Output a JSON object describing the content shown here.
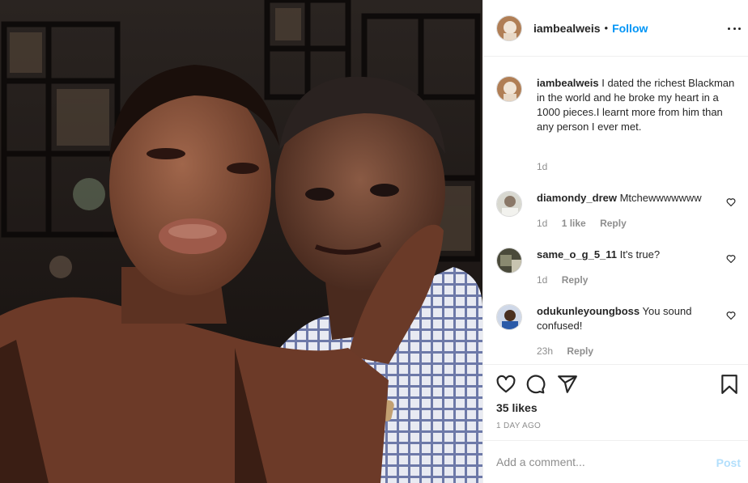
{
  "post": {
    "username": "iambealweis",
    "separator": "•",
    "follow_label": "Follow",
    "more_icon": "more-horizontal-icon"
  },
  "caption": {
    "username": "iambealweis",
    "text": " I dated the richest Blackman in the world and he broke my heart in a 1000 pieces.I learnt more from him than any person I ever met.",
    "time": "1d"
  },
  "comments": [
    {
      "username": "diamondy_drew",
      "text": " Mtchewwwwwww",
      "time": "1d",
      "likes": "1 like",
      "reply": "Reply"
    },
    {
      "username": "same_o_g_5_11",
      "text": " It's true?",
      "time": "1d",
      "reply": "Reply"
    },
    {
      "username": "odukunleyoungboss",
      "text": " You sound confused!",
      "time": "23h",
      "reply": "Reply"
    }
  ],
  "actions": {
    "likes": "35 likes",
    "date": "1 DAY AGO",
    "icons": [
      "heart-icon",
      "comment-icon",
      "share-icon",
      "bookmark-icon"
    ]
  },
  "add_comment": {
    "placeholder": "Add a comment...",
    "post_label": "Post"
  },
  "colors": {
    "accent": "#0095f6",
    "post_disabled": "#b2dffc",
    "muted": "#8e8e8e",
    "divider": "#efefef"
  }
}
